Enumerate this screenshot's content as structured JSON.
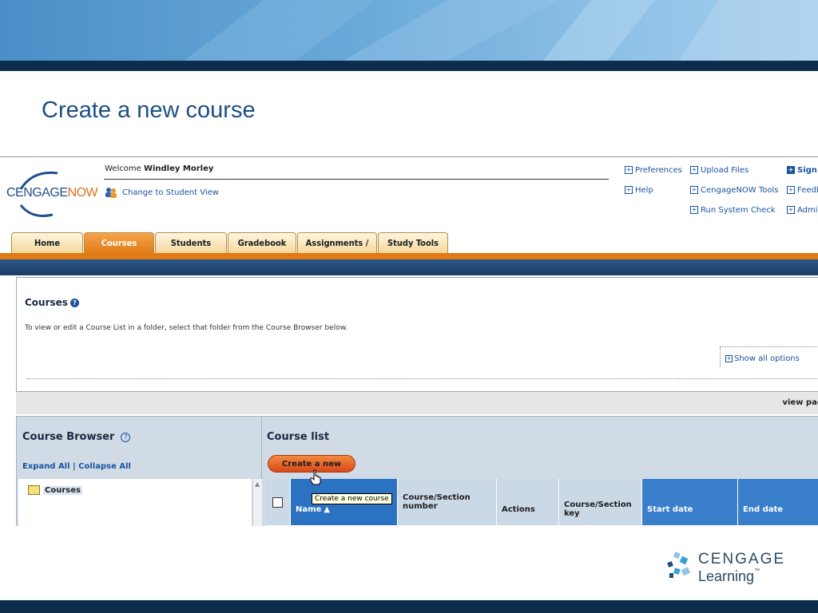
{
  "slide": {
    "title": "Create a new course",
    "logo": {
      "word1": "CENGAGE",
      "word2": "Learning",
      "tm": "™"
    }
  },
  "app": {
    "logo_text_a": "CENGAGE",
    "logo_text_b": "NOW",
    "welcome_prefix": "Welcome",
    "user_name": "Windley Morley",
    "student_view": "Change to Student View",
    "links": {
      "preferences": "Preferences",
      "upload_files": "Upload Files",
      "sign_out": "Sign O",
      "help": "Help",
      "cengagenow_tools": "CengageNOW Tools",
      "feedback": "Feedb",
      "run_system_check": "Run System Check",
      "admin": "Admin"
    },
    "tabs": [
      "Home",
      "Courses",
      "Students",
      "Gradebook",
      "Assignments / Tests",
      "Study Tools"
    ],
    "active_tab": "Courses",
    "courses": {
      "title": "Courses",
      "help_glyph": "?",
      "description": "To view or edit a Course List in a folder, select that folder from the Course Browser below.",
      "show_all_options": "Show all options"
    },
    "view_page": "view pag",
    "browser": {
      "title": "Course Browser",
      "expand_all": "Expand All",
      "separator": "|",
      "collapse_all": "Collapse All",
      "folder": "Courses"
    },
    "course_list": {
      "title": "Course list",
      "create_button": "Create a new course",
      "tooltip": "Create a new course",
      "columns": {
        "name": "Name",
        "course_section_number_1": "Course/Section",
        "course_section_number_2": "number",
        "actions": "Actions",
        "course_section_key": "Course/Section key",
        "start_date": "Start date",
        "end_date": "End date"
      }
    }
  },
  "colors": {
    "slide_title": "#1b4e84",
    "active_tab": "#e07d18",
    "button": "#d8481b",
    "header_blue": "#2c72c2"
  }
}
